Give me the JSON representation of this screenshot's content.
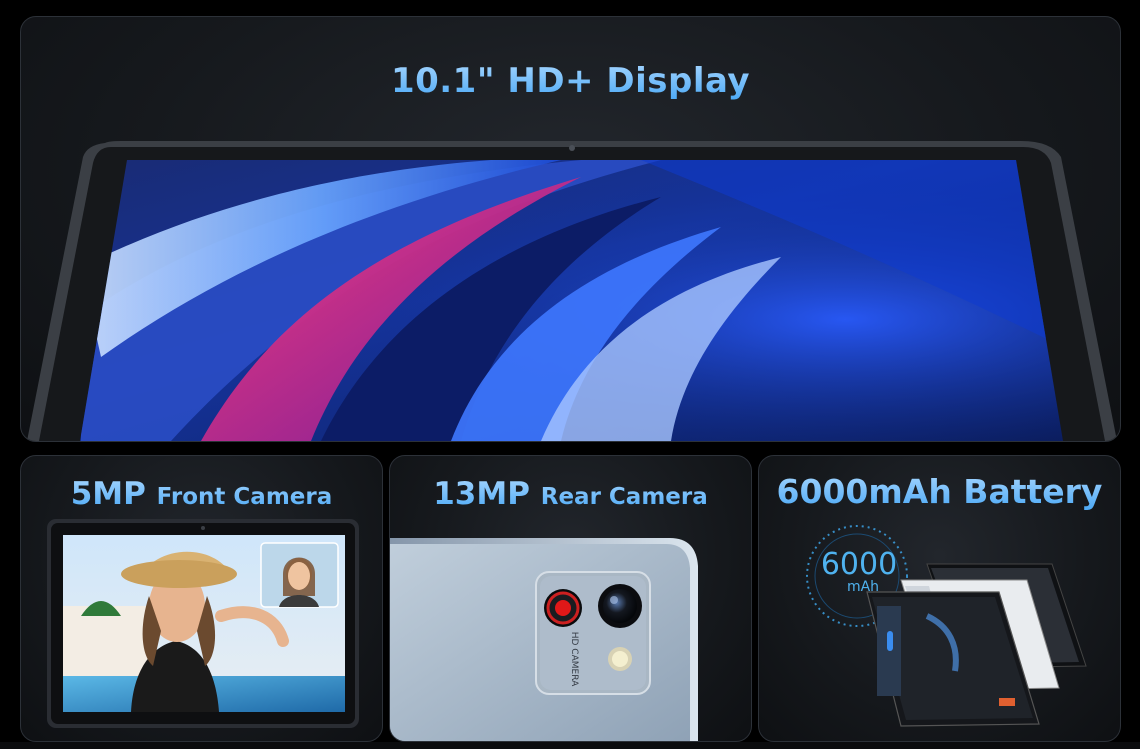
{
  "display": {
    "title": "10.1\" HD+ Display"
  },
  "front_camera": {
    "value": "5MP",
    "label": "Front Camera"
  },
  "rear_camera": {
    "value": "13MP",
    "label": "Rear Camera",
    "lens_label": "HD CAMERA"
  },
  "battery": {
    "title": "6000mAh Battery",
    "gauge_value": "6000",
    "gauge_unit": "mAh"
  },
  "colors": {
    "accent_light": "#a6d6ff",
    "accent": "#4aa8f5",
    "panel_border": "#2c3138"
  }
}
